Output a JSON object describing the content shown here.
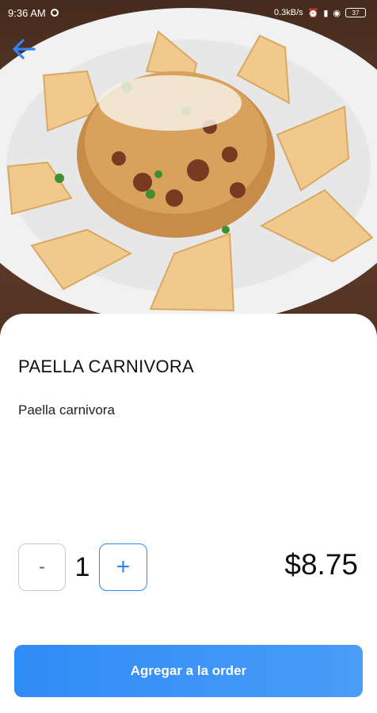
{
  "status_bar": {
    "time": "9:36 AM",
    "network": "0.3kB/s",
    "battery": "37"
  },
  "icons": {
    "back": "arrow-left-icon",
    "time_indicator": "status-circle-icon"
  },
  "colors": {
    "accent": "#2f86f6",
    "button_gradient_start": "#2f8cf6",
    "button_gradient_end": "#4a9cf7"
  },
  "product": {
    "title": "PAELLA CARNIVORA",
    "description": "Paella carnivora",
    "price": "$8.75"
  },
  "quantity": {
    "minus_label": "-",
    "value": "1",
    "plus_label": "+"
  },
  "actions": {
    "add_to_order": "Agregar a la order"
  }
}
